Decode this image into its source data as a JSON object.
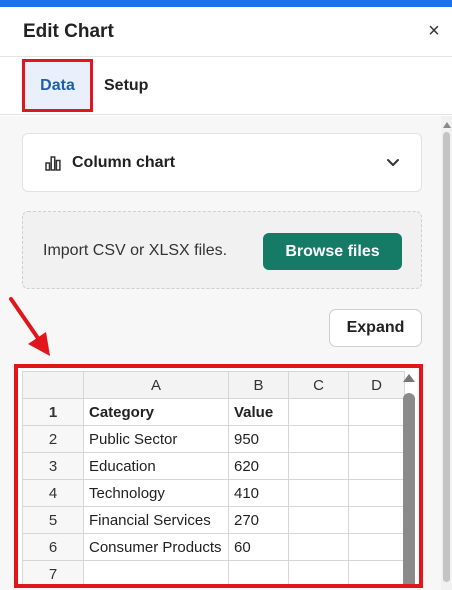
{
  "header": {
    "title": "Edit Chart",
    "close_label": "×"
  },
  "tabs": [
    {
      "label": "Data",
      "active": true
    },
    {
      "label": "Setup",
      "active": false
    }
  ],
  "chart_type": {
    "label": "Column chart",
    "icon": "column-chart-icon"
  },
  "import": {
    "text": "Import CSV or XLSX files.",
    "button": "Browse files"
  },
  "expand_label": "Expand",
  "sheet": {
    "columns": [
      "A",
      "B",
      "C",
      "D"
    ],
    "rows": [
      {
        "num": "1",
        "cells": [
          "Category",
          "Value",
          "",
          ""
        ]
      },
      {
        "num": "2",
        "cells": [
          "Public Sector",
          "950",
          "",
          ""
        ]
      },
      {
        "num": "3",
        "cells": [
          "Education",
          "620",
          "",
          ""
        ]
      },
      {
        "num": "4",
        "cells": [
          "Technology",
          "410",
          "",
          ""
        ]
      },
      {
        "num": "5",
        "cells": [
          "Financial Services",
          "270",
          "",
          ""
        ]
      },
      {
        "num": "6",
        "cells": [
          "Consumer Products",
          "60",
          "",
          ""
        ]
      },
      {
        "num": "7",
        "cells": [
          "",
          "",
          "",
          ""
        ]
      }
    ]
  },
  "colors": {
    "accent": "#1a73e8",
    "highlight": "#e0161b",
    "browse_button": "#157a66",
    "active_tab_text": "#1f5fa8"
  }
}
